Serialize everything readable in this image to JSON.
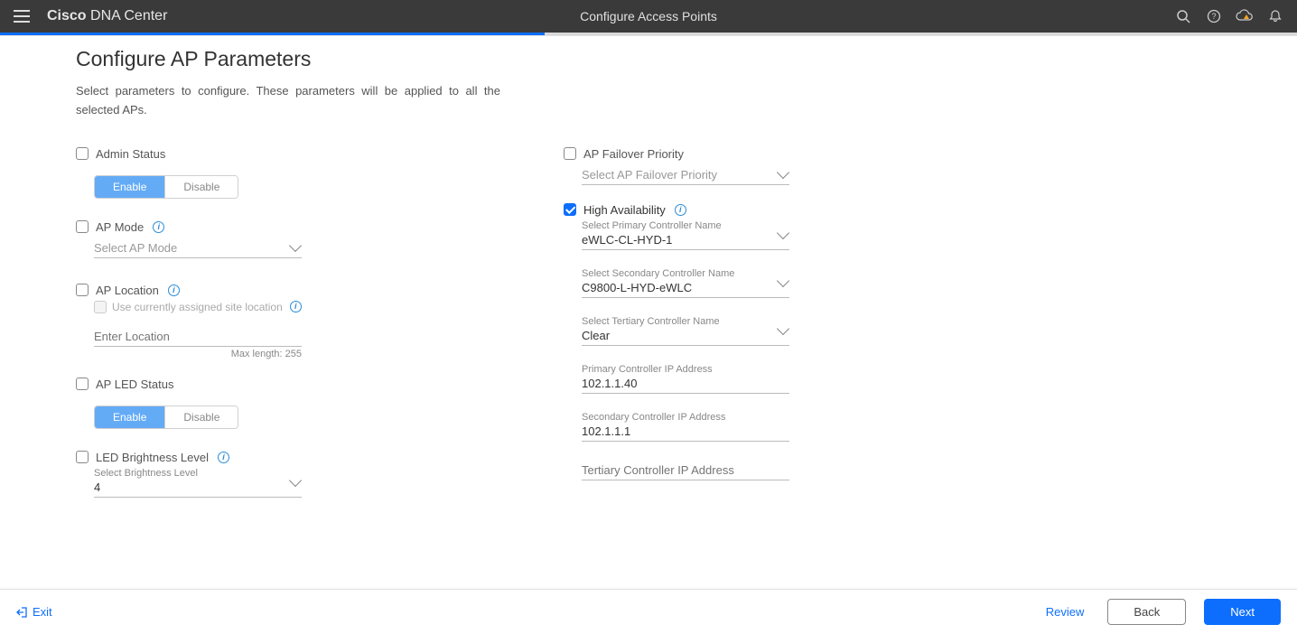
{
  "header": {
    "brand_bold": "Cisco",
    "brand_light": "DNA Center",
    "page_title": "Configure Access Points"
  },
  "progress_percent": 42,
  "main": {
    "title": "Configure AP Parameters",
    "subtitle": "Select parameters to configure. These parameters will be applied to all the selected APs."
  },
  "left": {
    "admin_status": {
      "label": "Admin Status",
      "checked": false,
      "enable": "Enable",
      "disable": "Disable",
      "active": "enable"
    },
    "ap_mode": {
      "label": "AP Mode",
      "checked": false,
      "placeholder": "Select AP Mode"
    },
    "ap_location": {
      "label": "AP Location",
      "checked": false,
      "use_current_label": "Use currently assigned site location",
      "use_current_checked": false,
      "input_placeholder": "Enter Location",
      "input_value": "",
      "hint": "Max length: 255"
    },
    "ap_led": {
      "label": "AP LED Status",
      "checked": false,
      "enable": "Enable",
      "disable": "Disable",
      "active": "enable"
    },
    "led_brightness": {
      "label": "LED Brightness Level",
      "checked": false,
      "small_label": "Select Brightness Level",
      "value": "4"
    }
  },
  "right": {
    "failover": {
      "label": "AP Failover Priority",
      "checked": false,
      "placeholder": "Select AP Failover Priority"
    },
    "ha": {
      "label": "High Availability",
      "checked": true,
      "primary_name_label": "Select Primary Controller Name",
      "primary_name_value": "eWLC-CL-HYD-1",
      "secondary_name_label": "Select Secondary Controller Name",
      "secondary_name_value": "C9800-L-HYD-eWLC",
      "tertiary_name_label": "Select Tertiary Controller Name",
      "tertiary_name_value": "Clear",
      "primary_ip_label": "Primary Controller IP Address",
      "primary_ip_value": "102.1.1.40",
      "secondary_ip_label": "Secondary Controller IP Address",
      "secondary_ip_value": "102.1.1.1",
      "tertiary_ip_label": "Tertiary Controller IP Address",
      "tertiary_ip_value": ""
    }
  },
  "footer": {
    "exit": "Exit",
    "review": "Review",
    "back": "Back",
    "next": "Next"
  }
}
